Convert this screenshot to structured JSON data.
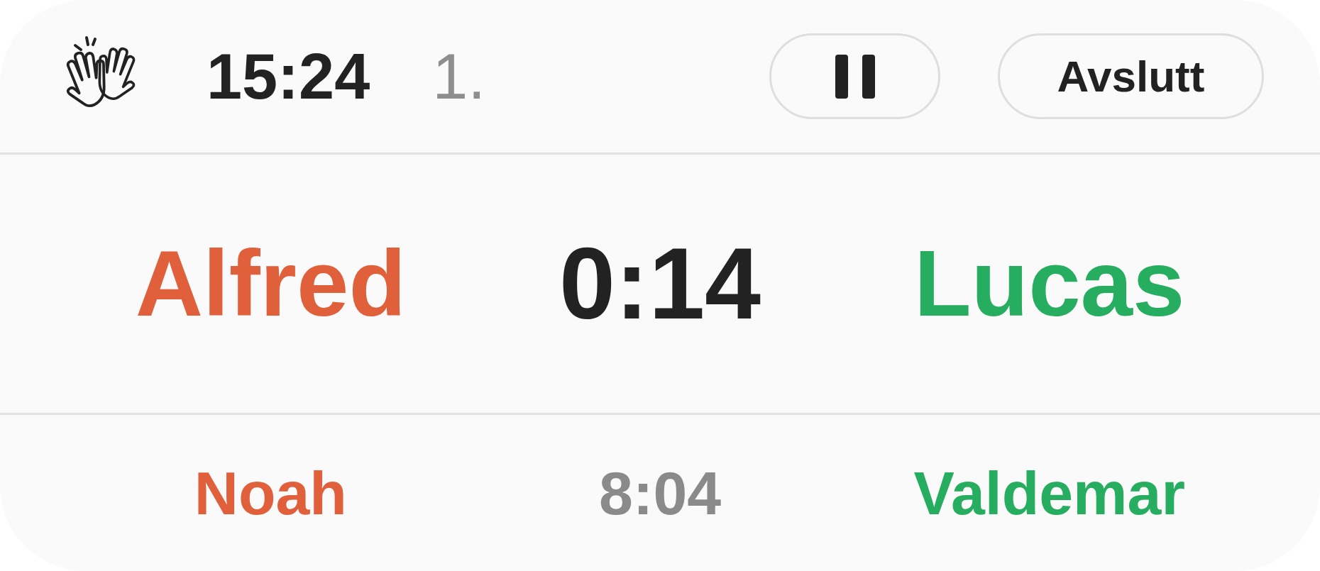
{
  "header": {
    "clock": "15:24",
    "period": "1.",
    "buttons": [
      {
        "kind": "pause"
      },
      {
        "kind": "text",
        "label": "Avslutt"
      }
    ]
  },
  "current_match": {
    "players": [
      {
        "name": "Alfred",
        "color": "#e0603b"
      },
      {
        "name": "Lucas",
        "color": "#27ad5f"
      }
    ],
    "time": "0:14"
  },
  "next_match": {
    "players": [
      {
        "name": "Noah",
        "color": "#e0603b"
      },
      {
        "name": "Valdemar",
        "color": "#27ad5f"
      }
    ],
    "time": "8:04"
  }
}
